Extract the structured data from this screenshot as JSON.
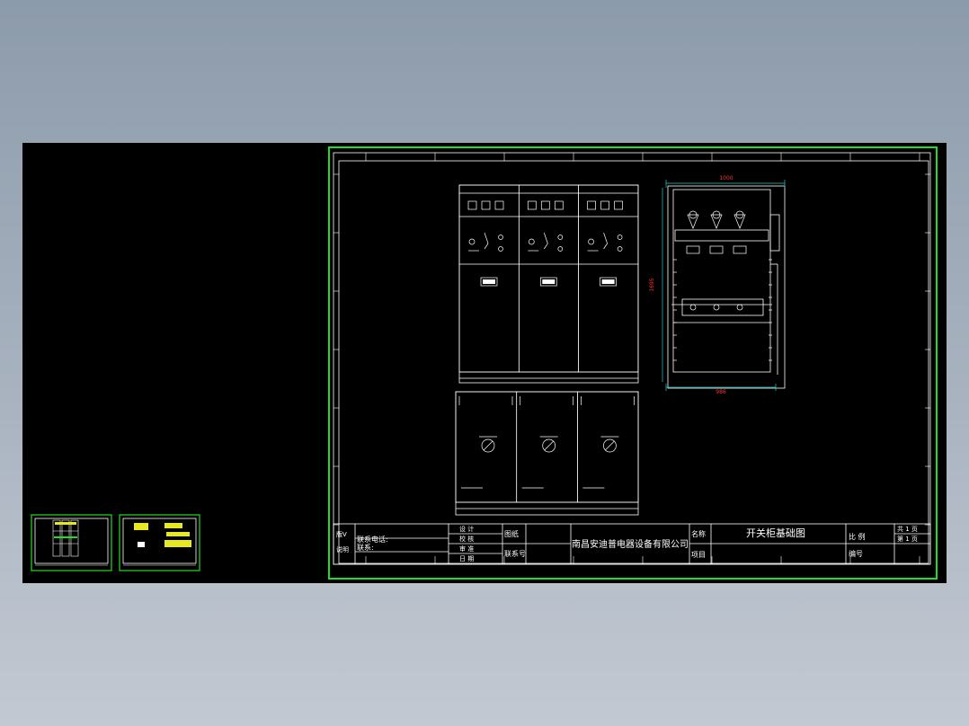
{
  "drawing": {
    "title": "开关柜基础图",
    "company": "南昌安迪普电器设备有限公司",
    "dimensions": {
      "width_top": "1000",
      "height_side": "1695",
      "width_bottom": "986"
    },
    "title_block": {
      "left_rows": [
        "联系电话:",
        "联系:"
      ],
      "left_side": [
        "版V",
        "说明"
      ],
      "sign_rows": [
        "设 计",
        "校 核",
        "审 准",
        "日 期"
      ],
      "mid_labels": [
        "图纸",
        "联系号"
      ],
      "name_label": "名称",
      "item_label": "项目",
      "scale_label": "比 例",
      "number_label": "编号",
      "sheet_total": "共 1 页",
      "sheet_no": "第 1 页"
    }
  },
  "colors": {
    "background_top": "#8c9bab",
    "background_bottom": "#c3c9d2",
    "canvas": "#000000",
    "viewport_frame": "#22dd22",
    "line": "#ffffff",
    "dimension": "#22cccc",
    "highlight": "#e8e820",
    "dimension_text": "#ff3030"
  },
  "thumbnails": [
    {
      "name": "thumbnail-1"
    },
    {
      "name": "thumbnail-2"
    }
  ]
}
